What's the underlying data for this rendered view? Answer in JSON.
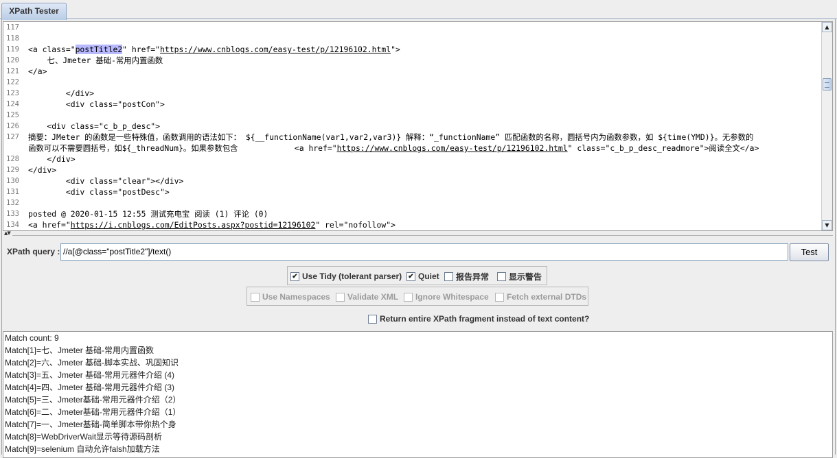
{
  "tab": {
    "label": "XPath Tester"
  },
  "editor": {
    "lines": [
      {
        "n": "117",
        "segs": []
      },
      {
        "n": "118",
        "segs": []
      },
      {
        "n": "119",
        "segs": [
          {
            "t": "<a class=\""
          },
          {
            "t": "postTitle2",
            "c": "hl"
          },
          {
            "t": "\" href=\""
          },
          {
            "t": "https://www.cnblogs.com/easy-test/p/12196102.html",
            "c": "u"
          },
          {
            "t": "\">"
          }
        ]
      },
      {
        "n": "120",
        "segs": [
          {
            "t": "    七、Jmeter 基础-常用内置函数"
          }
        ]
      },
      {
        "n": "121",
        "segs": [
          {
            "t": "</a>"
          }
        ]
      },
      {
        "n": "122",
        "segs": []
      },
      {
        "n": "123",
        "segs": [
          {
            "t": "        </div>"
          }
        ]
      },
      {
        "n": "124",
        "segs": [
          {
            "t": "        <div class=\"postCon\">"
          }
        ]
      },
      {
        "n": "125",
        "segs": []
      },
      {
        "n": "126",
        "segs": [
          {
            "t": "    <div class=\"c_b_p_desc\">"
          }
        ]
      },
      {
        "n": "127",
        "wrap": true,
        "segs": [
          {
            "t": "摘要：JMeter 的函数是一些特殊值，函数调用的语法如下： ${__functionName(var1,var2,var3)} 解释：“_functionName” 匹配函数的名称，圆括号内为函数参数，如 ${time(YMD)}。无参数的"
          }
        ],
        "segs2": [
          {
            "t": "函数可以不需要圆括号，如${_threadNum}。如果参数包含            <a href=\""
          },
          {
            "t": "https://www.cnblogs.com/easy-test/p/12196102.html",
            "c": "u"
          },
          {
            "t": "\" class=\"c_b_p_desc_readmore\">阅读全文</a>"
          }
        ]
      },
      {
        "n": "128",
        "segs": [
          {
            "t": "    </div>"
          }
        ]
      },
      {
        "n": "129",
        "segs": [
          {
            "t": "</div>"
          }
        ]
      },
      {
        "n": "130",
        "segs": [
          {
            "t": "        <div class=\"clear\"></div>"
          }
        ]
      },
      {
        "n": "131",
        "segs": [
          {
            "t": "        <div class=\"postDesc\">"
          }
        ]
      },
      {
        "n": "132",
        "segs": []
      },
      {
        "n": "133",
        "segs": [
          {
            "t": "posted @ 2020-01-15 12:55 测试充电宝 阅读 (1) 评论 (0)"
          }
        ]
      },
      {
        "n": "134",
        "segs": [
          {
            "t": "<a href=\""
          },
          {
            "t": "https://i.cnblogs.com/EditPosts.aspx?postid=12196102",
            "c": "u"
          },
          {
            "t": "\" rel=\"nofollow\">"
          }
        ]
      }
    ]
  },
  "query": {
    "label": "XPath query :",
    "value": "//a[@class=\"postTitle2\"]/text()",
    "button": "Test"
  },
  "options_row1": {
    "use_tidy": {
      "label": "Use Tidy (tolerant parser)",
      "checked": true
    },
    "quiet": {
      "label": "Quiet",
      "checked": true
    },
    "report_errors": {
      "label": "报告异常",
      "checked": false
    },
    "show_warnings": {
      "label": "显示警告",
      "checked": false
    }
  },
  "options_row2": {
    "use_namespaces": {
      "label": "Use Namespaces",
      "checked": false
    },
    "validate_xml": {
      "label": "Validate XML",
      "checked": false
    },
    "ignore_whitespace": {
      "label": "Ignore Whitespace",
      "checked": false
    },
    "fetch_dtds": {
      "label": "Fetch external DTDs",
      "checked": false
    }
  },
  "return_fragment": {
    "label": "Return entire XPath fragment instead of text content?",
    "checked": false
  },
  "results": {
    "lines": [
      "Match count: 9",
      "Match[1]=七、Jmeter 基础-常用内置函数",
      "Match[2]=六、Jmeter 基础-脚本实战、巩固知识",
      "Match[3]=五、Jmeter 基础-常用元器件介绍 (4)",
      "Match[4]=四、Jmeter 基础-常用元器件介绍 (3)",
      "Match[5]=三、Jmeter基础-常用元器件介绍（2）",
      "Match[6]=二、Jmeter基础-常用元器件介绍（1）",
      "Match[7]=一、Jmeter基础-简单脚本带你热个身",
      "Match[8]=WebDriverWait显示等待源码剖析",
      "Match[9]=selenium 自动允许falsh加载方法"
    ]
  }
}
